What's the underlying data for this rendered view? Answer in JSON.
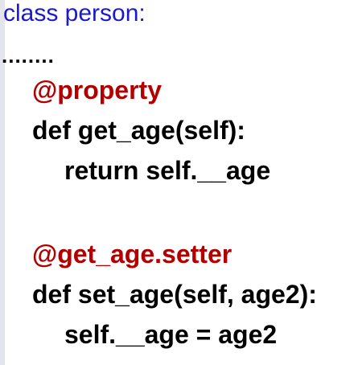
{
  "code": {
    "header": "class person:",
    "ellipsis": "........",
    "getter_decorator": "@property",
    "getter_def": "def get_age(self):",
    "getter_body": "return self.__age",
    "setter_decorator": "@get_age.setter",
    "setter_def": "def set_age(self, age2):",
    "setter_body": "self.__age = age2"
  },
  "colors": {
    "header": "#1a1acc",
    "decorator": "#b20000",
    "code": "#000000"
  }
}
